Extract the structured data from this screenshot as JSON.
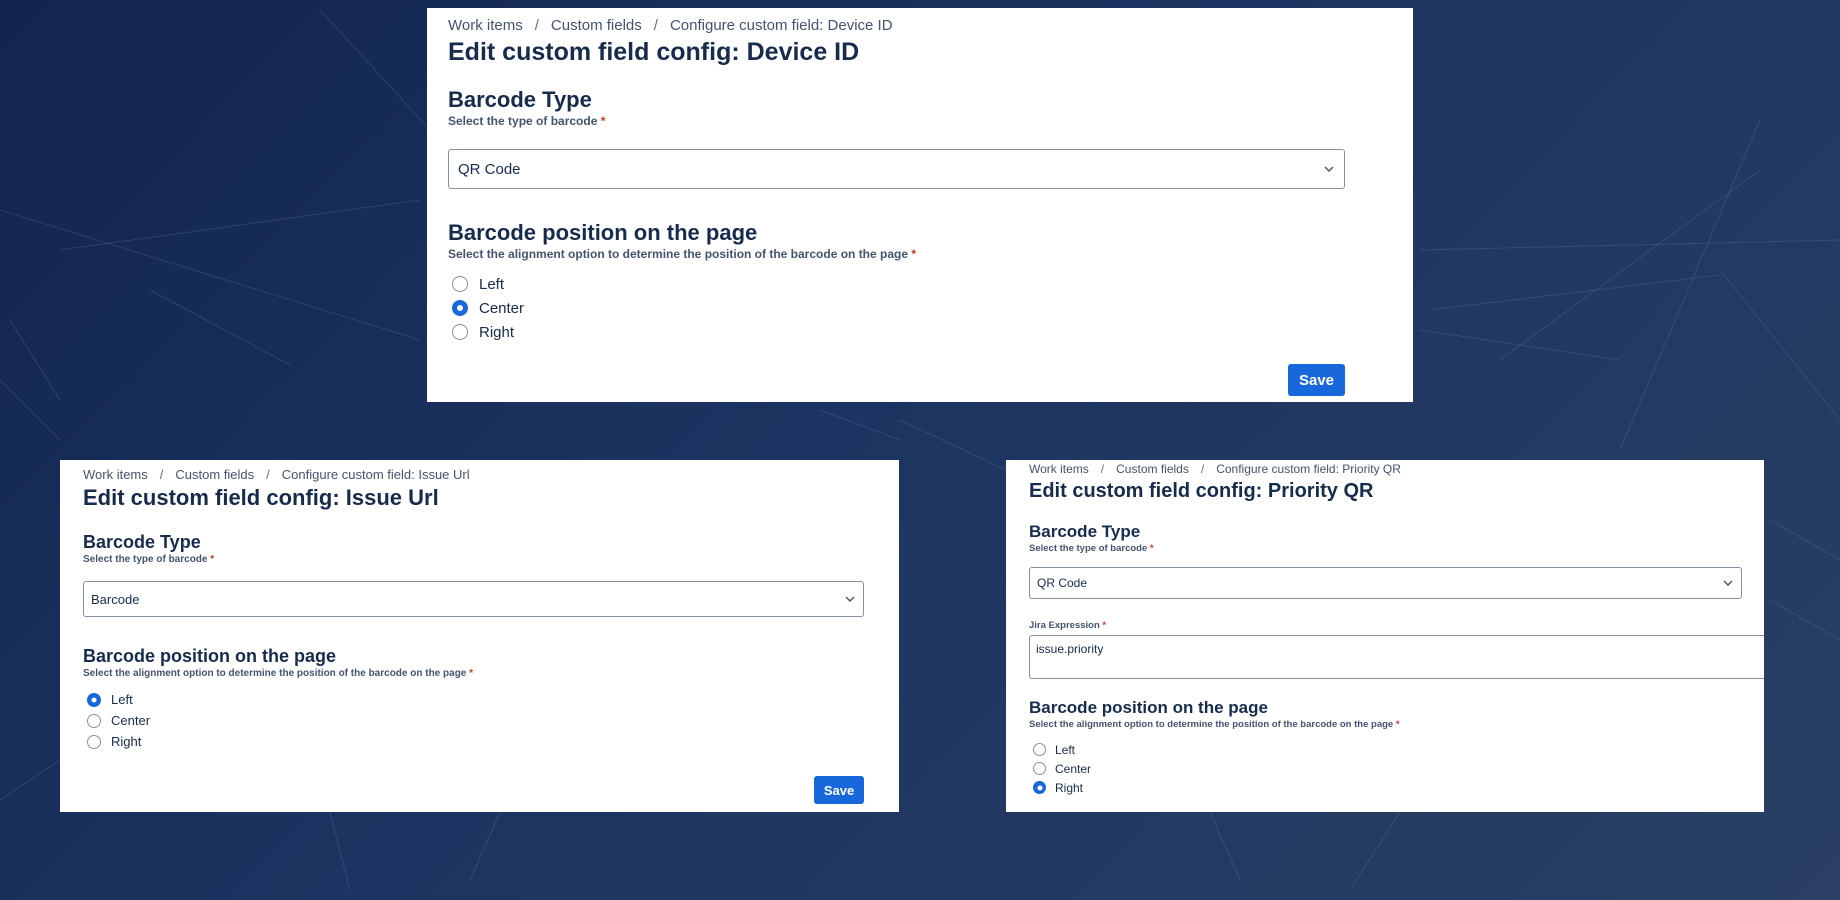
{
  "background": {
    "color_start": "#132450",
    "color_end": "#2a3f63"
  },
  "accent_color": "#1868db",
  "required_color": "#c9372c",
  "panels": [
    {
      "breadcrumb": [
        "Work items",
        "Custom fields",
        "Configure custom field: Device ID"
      ],
      "title": "Edit custom field config: Device ID",
      "barcode_type": {
        "heading": "Barcode Type",
        "hint": "Select the type of barcode",
        "required_mark": "*",
        "selected": "QR Code"
      },
      "position": {
        "heading": "Barcode position on the page",
        "hint": "Select the alignment option to determine the position of the barcode on the page",
        "required_mark": "*",
        "options": [
          "Left",
          "Center",
          "Right"
        ],
        "selected": "Center"
      },
      "save_label": "Save"
    },
    {
      "breadcrumb": [
        "Work items",
        "Custom fields",
        "Configure custom field: Issue Url"
      ],
      "title": "Edit custom field config: Issue Url",
      "barcode_type": {
        "heading": "Barcode Type",
        "hint": "Select the type of barcode",
        "required_mark": "*",
        "selected": "Barcode"
      },
      "position": {
        "heading": "Barcode position on the page",
        "hint": "Select the alignment option to determine the position of the barcode on the page",
        "required_mark": "*",
        "options": [
          "Left",
          "Center",
          "Right"
        ],
        "selected": "Left"
      },
      "save_label": "Save"
    },
    {
      "breadcrumb": [
        "Work items",
        "Custom fields",
        "Configure custom field: Priority QR"
      ],
      "title": "Edit custom field config: Priority QR",
      "barcode_type": {
        "heading": "Barcode Type",
        "hint": "Select the type of barcode",
        "required_mark": "*",
        "selected": "QR Code"
      },
      "jira_expression": {
        "label": "Jira Expression",
        "required_mark": "*",
        "value": "issue.priority"
      },
      "position": {
        "heading": "Barcode position on the page",
        "hint": "Select the alignment option to determine the position of the barcode on the page",
        "required_mark": "*",
        "options": [
          "Left",
          "Center",
          "Right"
        ],
        "selected": "Right"
      }
    }
  ]
}
